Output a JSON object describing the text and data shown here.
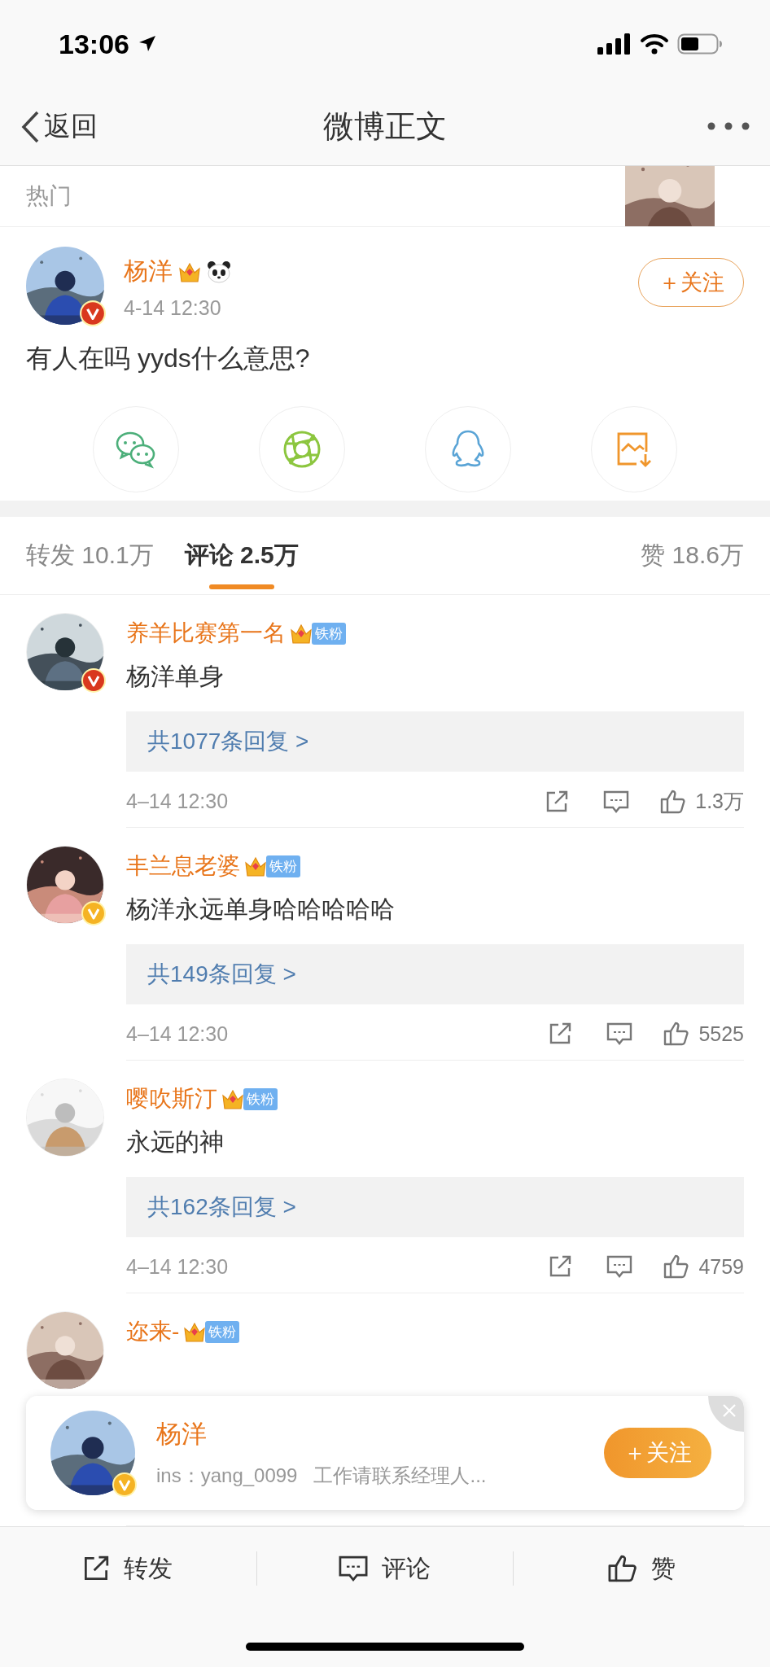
{
  "status_bar": {
    "time": "13:06"
  },
  "nav": {
    "back": "返回",
    "title": "微博正文"
  },
  "hot_bar": {
    "label": "热门"
  },
  "post": {
    "author": "杨洋",
    "verified": {
      "color": "#d9381e"
    },
    "time": "4-14 12:30",
    "follow": "＋关注",
    "text": "有人在吗 yyds什么意思?",
    "share_targets": [
      {
        "kind": "wechat"
      },
      {
        "kind": "moments"
      },
      {
        "kind": "qq"
      },
      {
        "kind": "save"
      }
    ]
  },
  "tabs": [
    {
      "label": "转发 10.1万",
      "selected": false
    },
    {
      "label": "评论 2.5万",
      "selected": true
    },
    {
      "label": "赞 18.6万",
      "selected": false
    }
  ],
  "comments": [
    {
      "name": "养羊比赛第一名",
      "badge": "铁粉",
      "verified": {
        "color": "#d9381e"
      },
      "text": "杨洋单身",
      "replies": "共1077条回复 >",
      "time": "4–14 12:30",
      "likes": "1.3万"
    },
    {
      "name": "丰兰息老婆",
      "badge": "铁粉",
      "verified": {
        "color": "#f5b324"
      },
      "text": "杨洋永远单身哈哈哈哈哈",
      "replies": "共149条回复 >",
      "time": "4–14 12:30",
      "likes": "5525"
    },
    {
      "name": "嘤吹斯汀",
      "badge": "铁粉",
      "text": "永远的神",
      "replies": "共162条回复 >",
      "time": "4–14 12:30",
      "likes": "4759"
    },
    {
      "name": "迩来-",
      "badge": "铁粉"
    }
  ],
  "popup": {
    "name": "杨洋",
    "verified": {
      "color": "#f5b324"
    },
    "bio": "ins：yang_0099   工作请联系经理人...",
    "follow": "＋关注"
  },
  "bottom_bar": [
    {
      "kind": "repost",
      "label": "转发"
    },
    {
      "kind": "comment",
      "label": "评论"
    },
    {
      "kind": "like",
      "label": "赞"
    }
  ]
}
